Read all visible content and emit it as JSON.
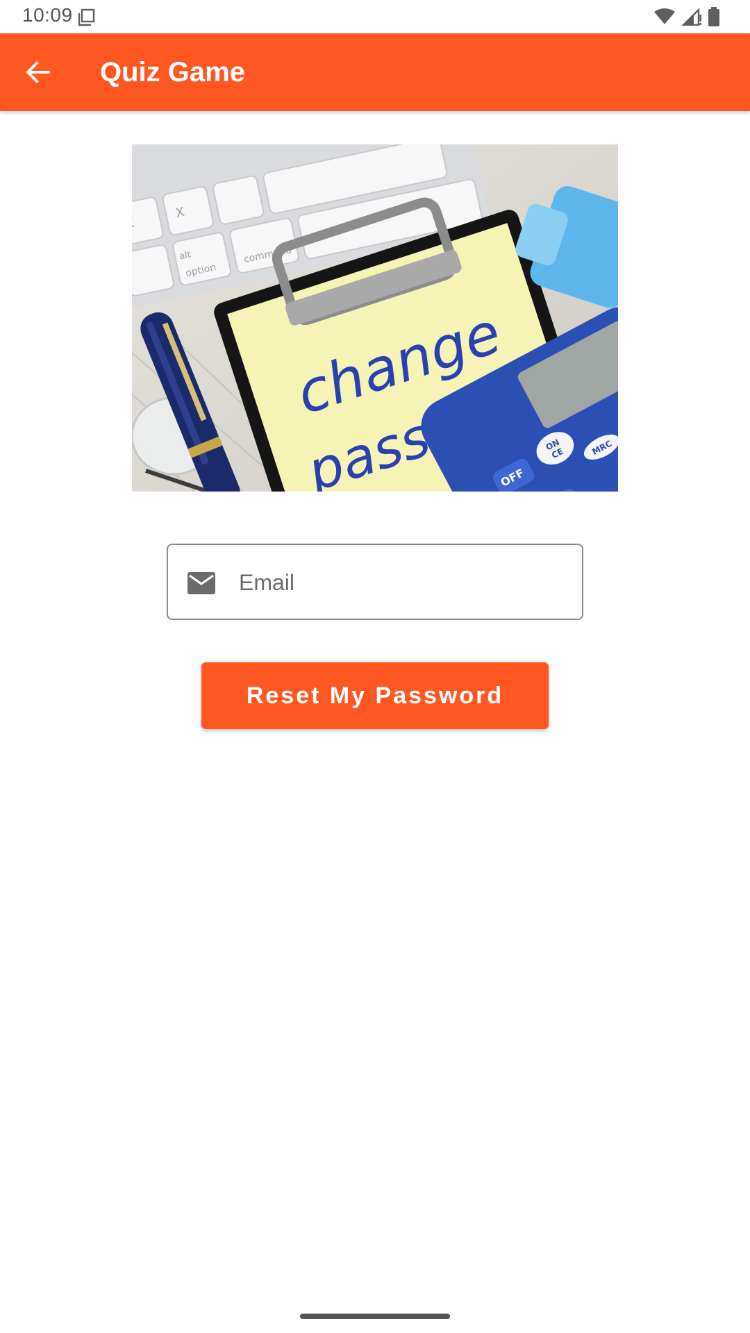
{
  "status_bar": {
    "time": "10:09"
  },
  "app_bar": {
    "title": "Quiz Game"
  },
  "hero_image": {
    "text_line1": "change",
    "text_line2": "password",
    "keyboard_key_alt": "alt",
    "keyboard_key_option": "option",
    "keyboard_key_command": "command",
    "keyboard_key_z": "Z",
    "keyboard_key_x": "X",
    "calc_on": "ON",
    "calc_ce": "CE",
    "calc_off": "OFF",
    "calc_mrc": "MRC"
  },
  "email_field": {
    "placeholder": "Email",
    "value": ""
  },
  "reset_button": {
    "label": "Reset My Password"
  },
  "colors": {
    "accent": "#ff5722"
  }
}
